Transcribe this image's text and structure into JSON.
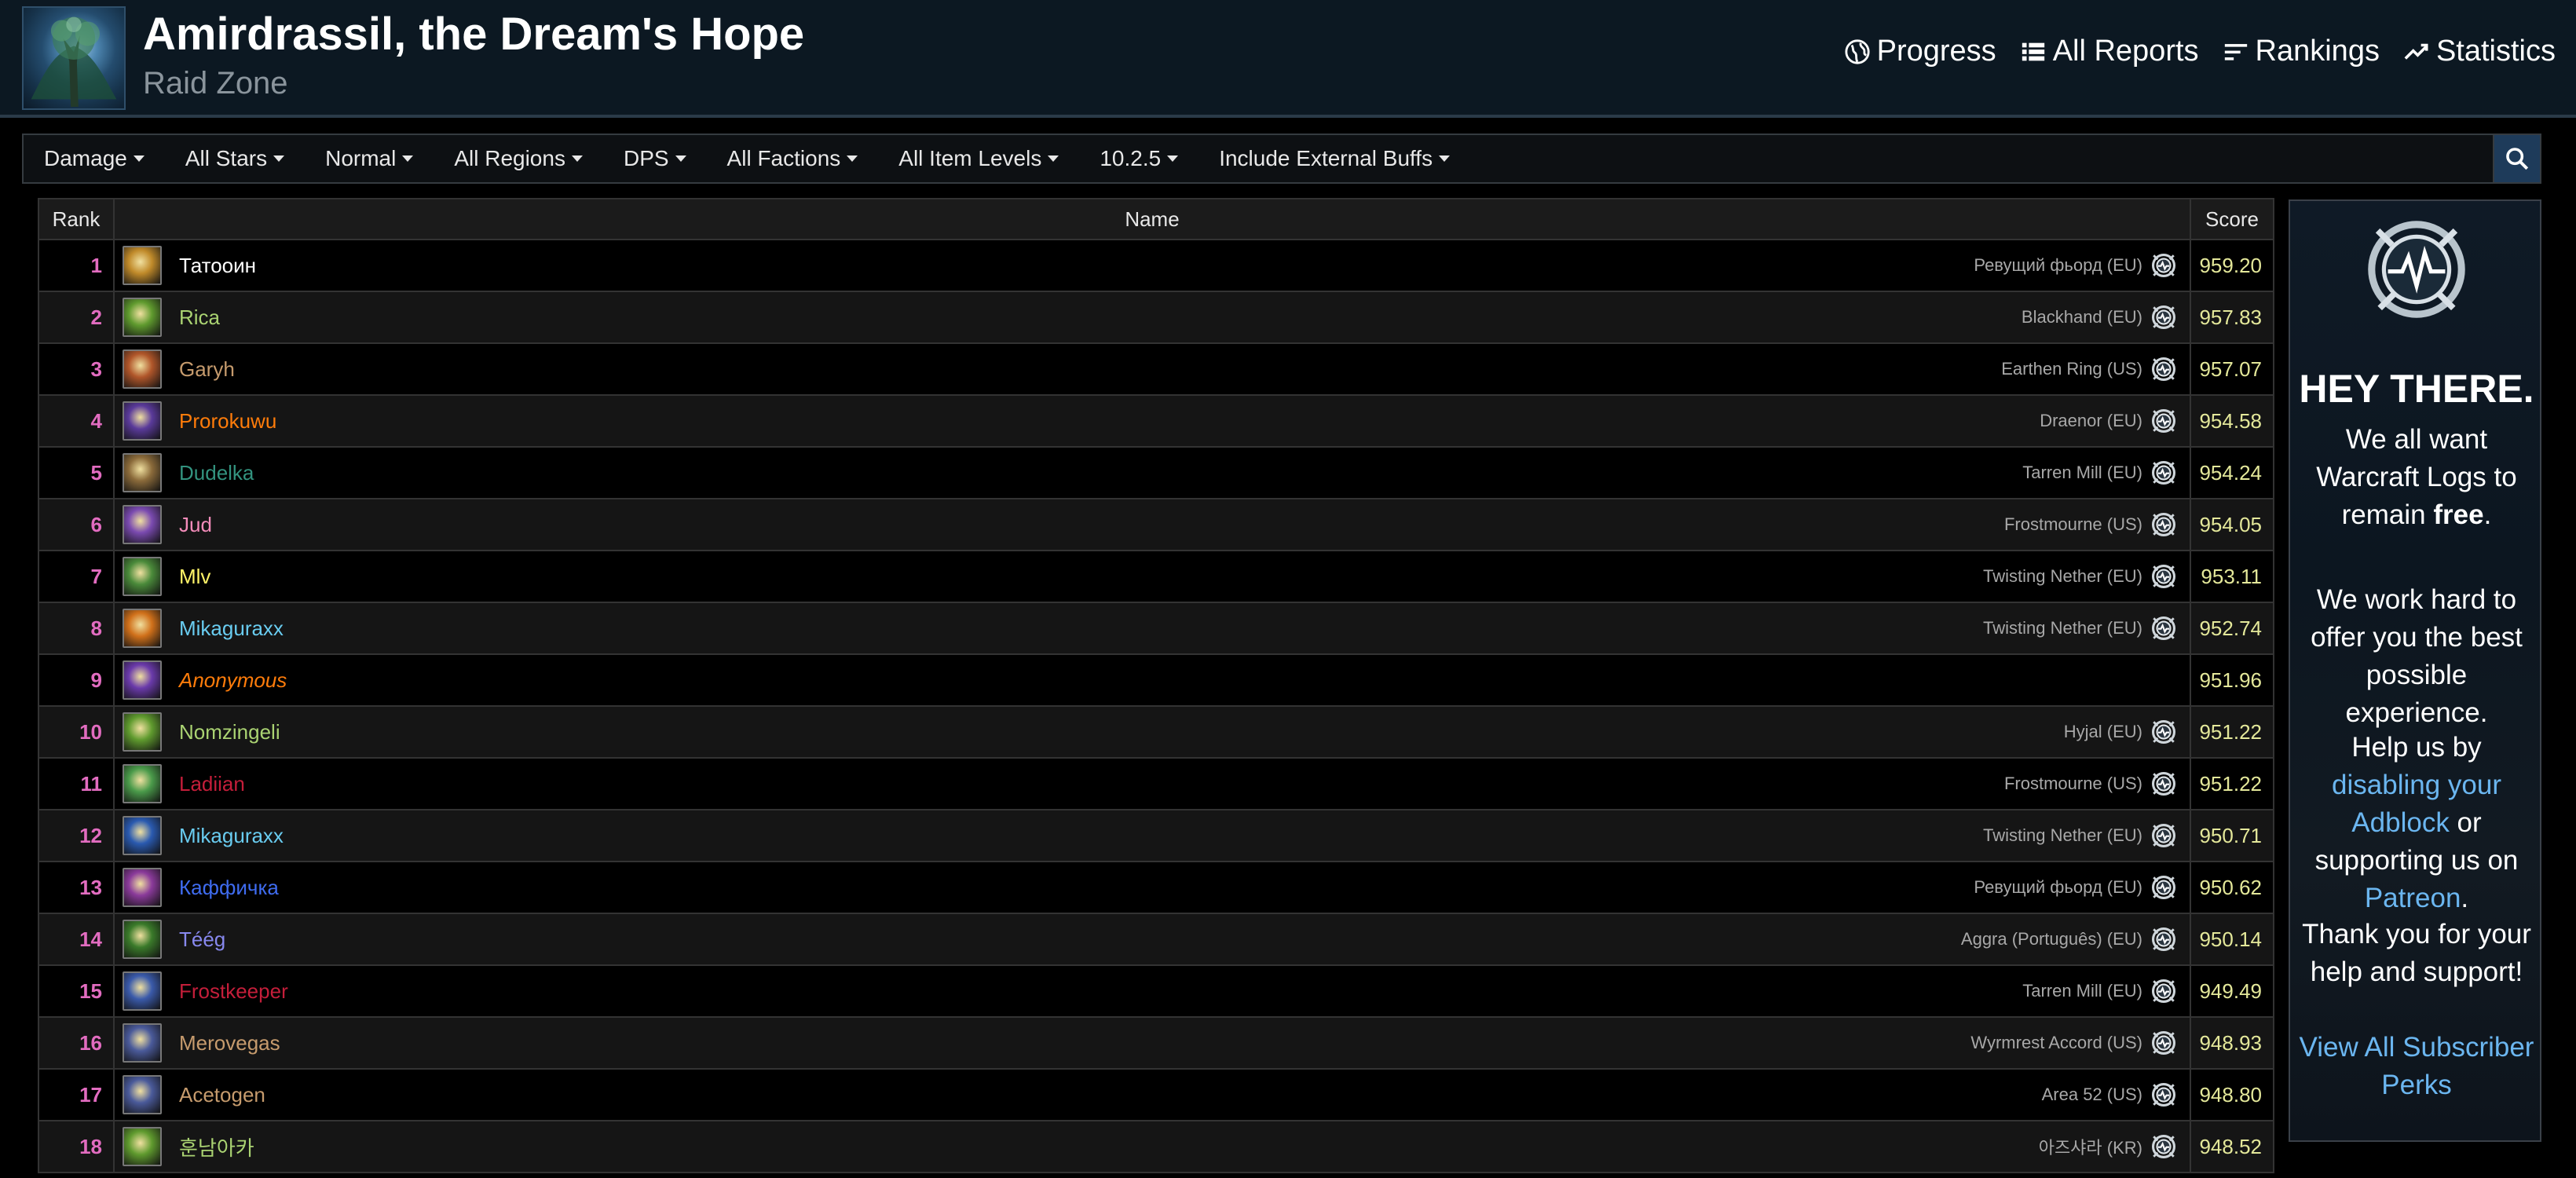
{
  "header": {
    "title": "Amirdrassil, the Dream's Hope",
    "subtitle": "Raid Zone",
    "nav": [
      {
        "label": "Progress",
        "icon": "globe-icon"
      },
      {
        "label": "All Reports",
        "icon": "list-icon"
      },
      {
        "label": "Rankings",
        "icon": "bars-icon"
      },
      {
        "label": "Statistics",
        "icon": "chart-icon"
      }
    ]
  },
  "filters": [
    {
      "label": "Damage"
    },
    {
      "label": "All Stars"
    },
    {
      "label": "Normal"
    },
    {
      "label": "All Regions"
    },
    {
      "label": "DPS"
    },
    {
      "label": "All Factions"
    },
    {
      "label": "All Item Levels"
    },
    {
      "label": "10.2.5"
    },
    {
      "label": "Include External Buffs"
    }
  ],
  "table": {
    "headers": {
      "rank": "Rank",
      "name": "Name",
      "score": "Score"
    },
    "rows": [
      {
        "rank": "1",
        "name": "Татооин",
        "server": "Ревущий фьорд (EU)",
        "score": "959.20",
        "name_color": "#ffffff",
        "icon_color": "#c08a2a",
        "italic": false
      },
      {
        "rank": "2",
        "name": "Rica",
        "server": "Blackhand (EU)",
        "score": "957.83",
        "name_color": "#aad372",
        "icon_color": "#5f9a2e",
        "italic": false
      },
      {
        "rank": "3",
        "name": "Garyh",
        "server": "Earthen Ring (US)",
        "score": "957.07",
        "name_color": "#c69b6d",
        "icon_color": "#b0562a",
        "italic": false
      },
      {
        "rank": "4",
        "name": "Prorokuwu",
        "server": "Draenor (EU)",
        "score": "954.58",
        "name_color": "#ff7c0a",
        "icon_color": "#5a3a9a",
        "italic": false
      },
      {
        "rank": "5",
        "name": "Dudelka",
        "server": "Tarren Mill (EU)",
        "score": "954.24",
        "name_color": "#33937f",
        "icon_color": "#8a6a3a",
        "italic": false
      },
      {
        "rank": "6",
        "name": "Jud",
        "server": "Frostmourne (US)",
        "score": "954.05",
        "name_color": "#f48cba",
        "icon_color": "#7a4ab0",
        "italic": false
      },
      {
        "rank": "7",
        "name": "Mlv",
        "server": "Twisting Nether (EU)",
        "score": "953.11",
        "name_color": "#fff468",
        "icon_color": "#4a8a3a",
        "italic": false
      },
      {
        "rank": "8",
        "name": "Mikaguraxx",
        "server": "Twisting Nether (EU)",
        "score": "952.74",
        "name_color": "#69ccf0",
        "icon_color": "#d0701a",
        "italic": false
      },
      {
        "rank": "9",
        "name": "Anonymous",
        "server": "",
        "score": "951.96",
        "name_color": "#ff7c0a",
        "icon_color": "#6a3aaa",
        "italic": true
      },
      {
        "rank": "10",
        "name": "Nomzingeli",
        "server": "Hyjal (EU)",
        "score": "951.22",
        "name_color": "#aad372",
        "icon_color": "#5f9a2e",
        "italic": false
      },
      {
        "rank": "11",
        "name": "Ladiian",
        "server": "Frostmourne (US)",
        "score": "951.22",
        "name_color": "#c41e3a",
        "icon_color": "#4a9a4a",
        "italic": false
      },
      {
        "rank": "12",
        "name": "Mikaguraxx",
        "server": "Twisting Nether (EU)",
        "score": "950.71",
        "name_color": "#69ccf0",
        "icon_color": "#2a5ab0",
        "italic": false
      },
      {
        "rank": "13",
        "name": "Каффичка",
        "server": "Ревущий фьорд (EU)",
        "score": "950.62",
        "name_color": "#3f6cf0",
        "icon_color": "#8a3a9a",
        "italic": false
      },
      {
        "rank": "14",
        "name": "Téég",
        "server": "Aggra (Português) (EU)",
        "score": "950.14",
        "name_color": "#8788ee",
        "icon_color": "#3a7a2a",
        "italic": false
      },
      {
        "rank": "15",
        "name": "Frostkeeper",
        "server": "Tarren Mill (EU)",
        "score": "949.49",
        "name_color": "#c41e3a",
        "icon_color": "#3a5aaa",
        "italic": false
      },
      {
        "rank": "16",
        "name": "Merovegas",
        "server": "Wyrmrest Accord (US)",
        "score": "948.93",
        "name_color": "#c69b6d",
        "icon_color": "#4a5a9a",
        "italic": false
      },
      {
        "rank": "17",
        "name": "Acetogen",
        "server": "Area 52 (US)",
        "score": "948.80",
        "name_color": "#c69b6d",
        "icon_color": "#4a5a9a",
        "italic": false
      },
      {
        "rank": "18",
        "name": "훈남아카",
        "server": "아즈샤라 (KR)",
        "score": "948.52",
        "name_color": "#aad372",
        "icon_color": "#5f9a2e",
        "italic": false
      }
    ]
  },
  "ad": {
    "heading": "HEY THERE.",
    "p1_a": "We all want Warcraft Logs to remain ",
    "p1_bold": "free",
    "p1_b": ".",
    "p2": "We work hard to offer you the best possible experience.",
    "p3_a": "Help us by ",
    "p3_link1": "disabling your Adblock",
    "p3_b": " or supporting us on ",
    "p3_link2": "Patreon",
    "p3_c": ".",
    "p4": "Thank you for your help and support!",
    "cta": "View All Subscriber Perks"
  },
  "colors": {
    "rank": "#e26cc0",
    "score": "#e4e89a",
    "link": "#6bb6f0",
    "header_bg": "#0c1822"
  }
}
